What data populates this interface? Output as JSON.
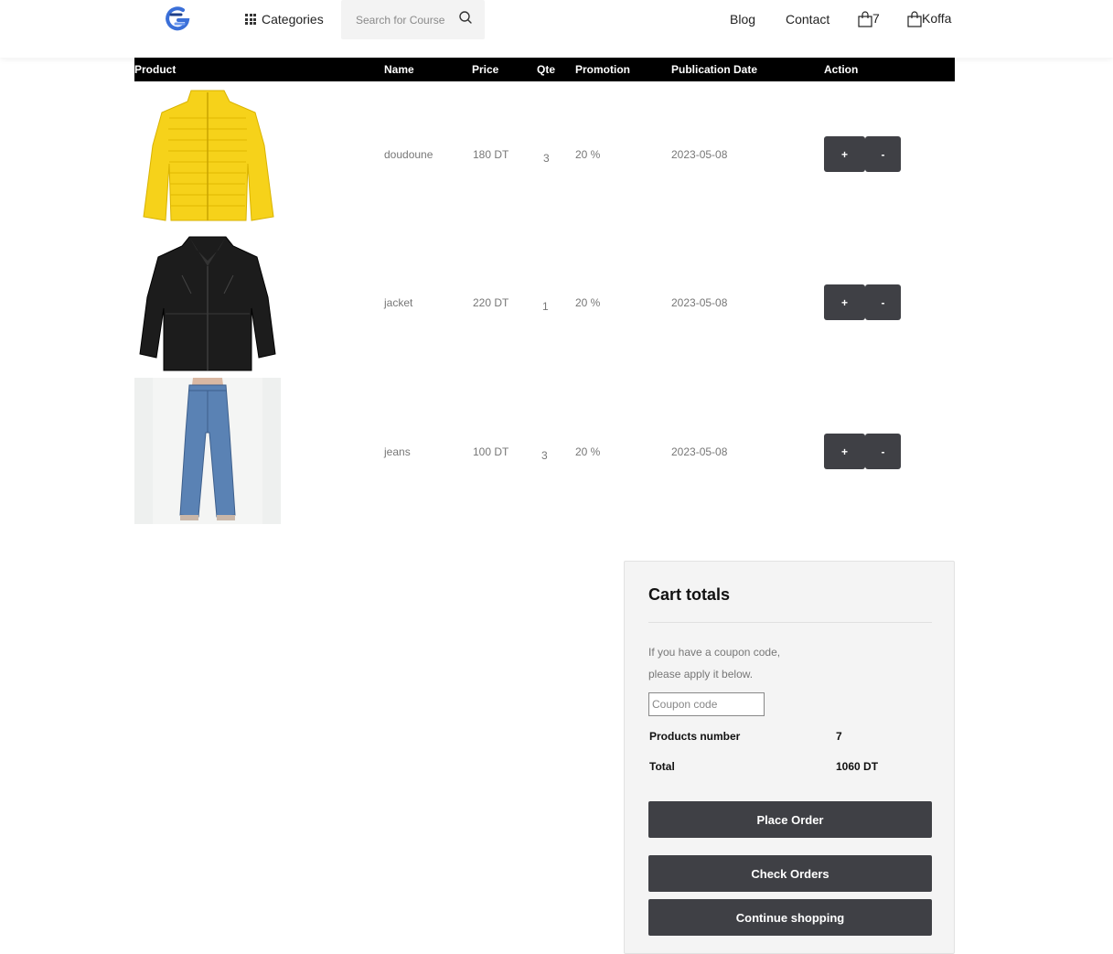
{
  "header": {
    "categories_label": "Categories",
    "search_placeholder": "Search for Course",
    "nav": [
      "Blog",
      "Contact"
    ],
    "cart_count": "7",
    "user_label": "Koffa"
  },
  "table": {
    "headers": [
      "Product",
      "Name",
      "Price",
      "Qte",
      "Promotion",
      "Publication Date",
      "Action"
    ],
    "rows": [
      {
        "name": "doudoune",
        "price": "180 DT",
        "qte": "3",
        "promotion": "20 %",
        "date": "2023-05-08",
        "plus": "+",
        "minus": "-"
      },
      {
        "name": "jacket",
        "price": "220 DT",
        "qte": "1",
        "promotion": "20 %",
        "date": "2023-05-08",
        "plus": "+",
        "minus": "-"
      },
      {
        "name": "jeans",
        "price": "100 DT",
        "qte": "3",
        "promotion": "20 %",
        "date": "2023-05-08",
        "plus": "+",
        "minus": "-"
      }
    ]
  },
  "totals": {
    "title": "Cart totals",
    "coupon_line1": "If you have a coupon code,",
    "coupon_line2": "please apply it below.",
    "coupon_placeholder": "Coupon code",
    "products_label": "Products number",
    "products_value": "7",
    "total_label": "Total",
    "total_value": "1060 DT",
    "place_order": "Place Order",
    "check_orders": "Check Orders",
    "continue_shopping": "Continue shopping"
  },
  "colors": {
    "header_bar": "#000000",
    "button": "#3f4045",
    "panel": "#f4f4f4",
    "logo": "#3a6fd8"
  }
}
